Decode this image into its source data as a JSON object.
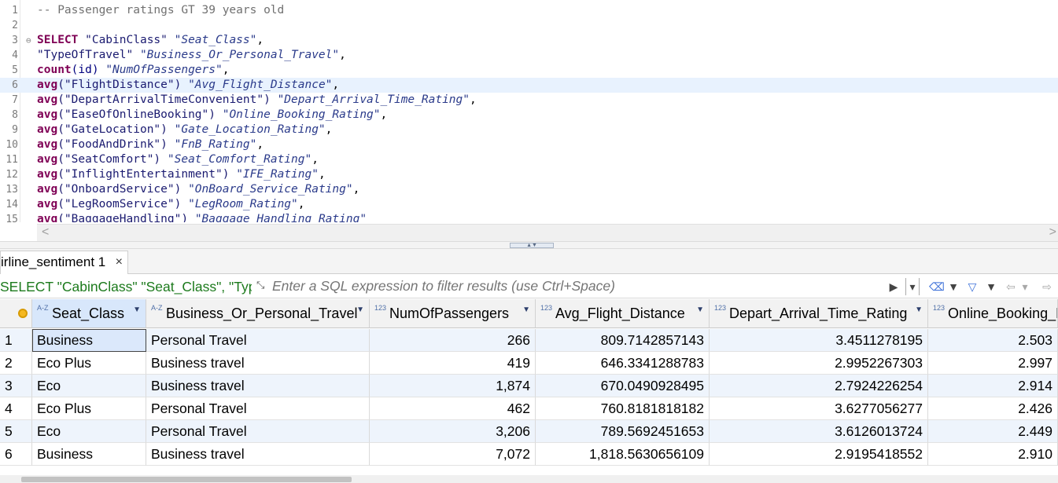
{
  "editor": {
    "lines": [
      {
        "n": "1",
        "tokens": [
          {
            "t": "-- Passenger ratings GT 39 years old",
            "c": "comment"
          }
        ]
      },
      {
        "n": "2",
        "tokens": []
      },
      {
        "n": "3",
        "fold": true,
        "tokens": [
          {
            "t": "SELECT",
            "c": "kw"
          },
          {
            "t": " \"CabinClass\" ",
            "c": "str"
          },
          {
            "t": "\"Seat_Class\"",
            "c": "alias"
          },
          {
            "t": ",",
            "c": "plain"
          }
        ]
      },
      {
        "n": "4",
        "tokens": [
          {
            "t": "\"TypeOfTravel\" ",
            "c": "str"
          },
          {
            "t": "\"Business_Or_Personal_Travel\"",
            "c": "alias"
          },
          {
            "t": ",",
            "c": "plain"
          }
        ]
      },
      {
        "n": "5",
        "tokens": [
          {
            "t": "count",
            "c": "kw"
          },
          {
            "t": "(id) ",
            "c": "fn"
          },
          {
            "t": "\"NumOfPassengers\"",
            "c": "alias"
          },
          {
            "t": ",",
            "c": "plain"
          }
        ]
      },
      {
        "n": "6",
        "current": true,
        "tokens": [
          {
            "t": "avg",
            "c": "kw"
          },
          {
            "t": "(\"FlightDistance\") ",
            "c": "str"
          },
          {
            "t": "\"Avg_Flight_Distance\"",
            "c": "alias"
          },
          {
            "t": ",",
            "c": "plain"
          }
        ]
      },
      {
        "n": "7",
        "tokens": [
          {
            "t": "avg",
            "c": "kw"
          },
          {
            "t": "(\"DepartArrivalTimeConvenient\") ",
            "c": "str"
          },
          {
            "t": "\"Depart_Arrival_Time_Rating\"",
            "c": "alias"
          },
          {
            "t": ",",
            "c": "plain"
          }
        ]
      },
      {
        "n": "8",
        "tokens": [
          {
            "t": "avg",
            "c": "kw"
          },
          {
            "t": "(\"EaseOfOnlineBooking\") ",
            "c": "str"
          },
          {
            "t": "\"Online_Booking_Rating\"",
            "c": "alias"
          },
          {
            "t": ",",
            "c": "plain"
          }
        ]
      },
      {
        "n": "9",
        "tokens": [
          {
            "t": "avg",
            "c": "kw"
          },
          {
            "t": "(\"GateLocation\") ",
            "c": "str"
          },
          {
            "t": "\"Gate_Location_Rating\"",
            "c": "alias"
          },
          {
            "t": ",",
            "c": "plain"
          }
        ]
      },
      {
        "n": "10",
        "tokens": [
          {
            "t": "avg",
            "c": "kw"
          },
          {
            "t": "(\"FoodAndDrink\") ",
            "c": "str"
          },
          {
            "t": "\"FnB_Rating\"",
            "c": "alias"
          },
          {
            "t": ",",
            "c": "plain"
          }
        ]
      },
      {
        "n": "11",
        "tokens": [
          {
            "t": "avg",
            "c": "kw"
          },
          {
            "t": "(\"SeatComfort\") ",
            "c": "str"
          },
          {
            "t": "\"Seat_Comfort_Rating\"",
            "c": "alias"
          },
          {
            "t": ",",
            "c": "plain"
          }
        ]
      },
      {
        "n": "12",
        "tokens": [
          {
            "t": "avg",
            "c": "kw"
          },
          {
            "t": "(\"InflightEntertainment\") ",
            "c": "str"
          },
          {
            "t": "\"IFE_Rating\"",
            "c": "alias"
          },
          {
            "t": ",",
            "c": "plain"
          }
        ]
      },
      {
        "n": "13",
        "tokens": [
          {
            "t": "avg",
            "c": "kw"
          },
          {
            "t": "(\"OnboardService\") ",
            "c": "str"
          },
          {
            "t": "\"OnBoard_Service_Rating\"",
            "c": "alias"
          },
          {
            "t": ",",
            "c": "plain"
          }
        ]
      },
      {
        "n": "14",
        "tokens": [
          {
            "t": "avg",
            "c": "kw"
          },
          {
            "t": "(\"LegRoomService\") ",
            "c": "str"
          },
          {
            "t": "\"LegRoom_Rating\"",
            "c": "alias"
          },
          {
            "t": ",",
            "c": "plain"
          }
        ]
      },
      {
        "n": "15",
        "tokens": [
          {
            "t": "avg",
            "c": "kw"
          },
          {
            "t": "(\"BaggageHandling\") ",
            "c": "str"
          },
          {
            "t": "\"Baggage_Handling_Rating\"",
            "c": "alias"
          }
        ]
      }
    ],
    "scroll_left": "<",
    "scroll_right": ">"
  },
  "results": {
    "tab_label": "irline_sentiment 1",
    "tab_close": "×",
    "query_preview": "SELECT \"CabinClass\" \"Seat_Class\", \"TypeOf",
    "filter_placeholder": "Enter a SQL expression to filter results (use Ctrl+Space)",
    "columns": [
      {
        "type": "A-Z",
        "label": "Seat_Class"
      },
      {
        "type": "A-Z",
        "label": "Business_Or_Personal_Travel"
      },
      {
        "type": "123",
        "label": "NumOfPassengers"
      },
      {
        "type": "123",
        "label": "Avg_Flight_Distance"
      },
      {
        "type": "123",
        "label": "Depart_Arrival_Time_Rating"
      },
      {
        "type": "123",
        "label": "Online_Booking_R"
      }
    ],
    "rows": [
      [
        "1",
        "Business",
        "Personal Travel",
        "266",
        "809.7142857143",
        "3.4511278195",
        "2.503"
      ],
      [
        "2",
        "Eco Plus",
        "Business travel",
        "419",
        "646.3341288783",
        "2.9952267303",
        "2.997"
      ],
      [
        "3",
        "Eco",
        "Business travel",
        "1,874",
        "670.0490928495",
        "2.7924226254",
        "2.914"
      ],
      [
        "4",
        "Eco Plus",
        "Personal Travel",
        "462",
        "760.8181818182",
        "3.6277056277",
        "2.426"
      ],
      [
        "5",
        "Eco",
        "Personal Travel",
        "3,206",
        "789.5692451653",
        "3.6126013724",
        "2.449"
      ],
      [
        "6",
        "Business",
        "Business travel",
        "7,072",
        "1,818.5630656109",
        "2.9195418552",
        "2.910"
      ]
    ]
  }
}
